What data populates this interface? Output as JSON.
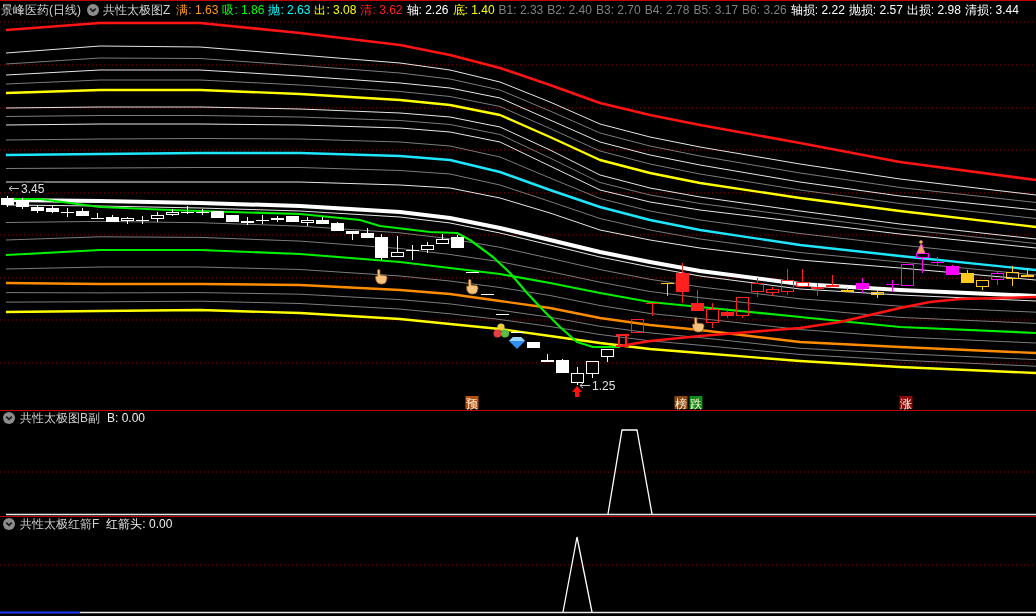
{
  "main_chart": {
    "title": "景峰医药(日线)",
    "indicator": "共性太极图Z",
    "readings": [
      {
        "text": "满: 1.63",
        "color": "#ff9a1e"
      },
      {
        "text": "吸: 1.86",
        "color": "#00ff00"
      },
      {
        "text": "抛: 2.63",
        "color": "#00ffff"
      },
      {
        "text": "出: 3.08",
        "color": "#ffff00"
      },
      {
        "text": "清: 3.62",
        "color": "#ff2020"
      },
      {
        "text": "轴: 2.26",
        "color": "#ffffff"
      },
      {
        "text": "底: 1.40",
        "color": "#ffff00"
      },
      {
        "text": "B1: 2.33",
        "color": "#808080"
      },
      {
        "text": "B2: 2.40",
        "color": "#808080"
      },
      {
        "text": "B3: 2.70",
        "color": "#808080"
      },
      {
        "text": "B4: 2.78",
        "color": "#808080"
      },
      {
        "text": "B5: 3.17",
        "color": "#808080"
      },
      {
        "text": "B6: 3.26",
        "color": "#808080"
      },
      {
        "text": "轴损: 2.22",
        "color": "#ffffff"
      },
      {
        "text": "抛损: 2.57",
        "color": "#ffffff"
      },
      {
        "text": "出损: 2.98",
        "color": "#ffffff"
      },
      {
        "text": "清损: 3.44",
        "color": "#ffffff"
      }
    ],
    "price_labels": [
      {
        "kind": "high",
        "text": "3.45"
      },
      {
        "kind": "low",
        "text": "1.25"
      }
    ],
    "signals": [
      {
        "text": "预",
        "color": "#b4500f"
      },
      {
        "text": "榜",
        "color": "#8c4a12"
      },
      {
        "text": "跌",
        "color": "#138a13"
      },
      {
        "text": "涨",
        "color": "#8c0c0c"
      }
    ]
  },
  "panels": [
    {
      "indicator": "共性太极图B副",
      "reading": "B: 0.00"
    },
    {
      "indicator": "共性太极红箭F",
      "reading": "红箭头: 0.00"
    }
  ]
}
